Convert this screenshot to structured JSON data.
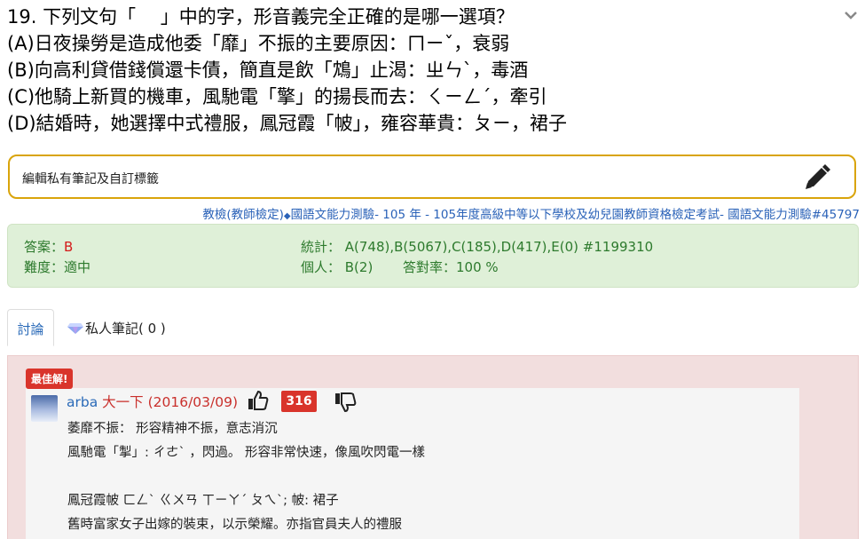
{
  "question": {
    "lines": [
      "19. 下列文句「　 」中的字，形音義完全正確的是哪一選項？",
      "(A)日夜操勞是造成他委「靡」不振的主要原因：ㄇㄧˇ，衰弱",
      "(B)向高利貸借錢償還卡債，簡直是飲「鴆」止渴：ㄓㄣˋ，毒酒",
      "(C)他騎上新買的機車，風馳電「擎」的揚長而去：ㄑㄧㄥˊ，牽引",
      "(D)結婚時，她選擇中式禮服，鳳冠霞「帔」，雍容華貴：ㄆㄧ，裙子"
    ]
  },
  "note": {
    "label": "編輯私有筆記及自訂標籤"
  },
  "source": {
    "part1": "教檢(教師檢定)",
    "diamond": "◆",
    "part2": "國語文能力測驗- 105 年 - 105年度高級中等以下學校及幼兒園教師資格檢定考試- 國語文能力測驗#45797"
  },
  "stats": {
    "answer_label": "答案：",
    "answer_value": "B",
    "difficulty": "難度：適中",
    "statistics": "統計： A(748),B(5067),C(185),D(417),E(0) #1199310",
    "personal": "個人： B(2)",
    "accuracy": "答對率：100 %"
  },
  "tabs": {
    "discussion": "討論",
    "private_notes": "私人筆記( 0 )"
  },
  "discussion": {
    "best_badge": "最佳解!",
    "user": "arba",
    "level": "大一下 (2016/03/09)",
    "likes": "316",
    "lines": [
      "萎靡不振： 形容精神不振，意志消沉",
      "風馳電「掣」: ㄔㄜˋ ，閃過。 形容非常快速，像風吹閃電一樣",
      "鳳冠霞帔 ㄈㄥˋ ㄍㄨㄢ ㄒㄧㄚˊ ㄆㄟˋ; 帔: 裙子",
      "舊時富家女子出嫁的裝束，以示榮耀。亦指官員夫人的禮服"
    ]
  },
  "icons": {
    "collapse": "chevron-down-icon",
    "edit": "pencil-icon",
    "gem": "gem-icon",
    "like": "thumbs-up-icon",
    "dislike": "thumbs-down-icon"
  },
  "colors": {
    "note_border": "#d9a40b",
    "link": "#2a62b8",
    "stats_bg": "#dff0d8",
    "stats_text": "#2d7a2d",
    "answer": "#d41a1a",
    "discussion_bg": "#f2dede",
    "badge": "#d9342b"
  }
}
